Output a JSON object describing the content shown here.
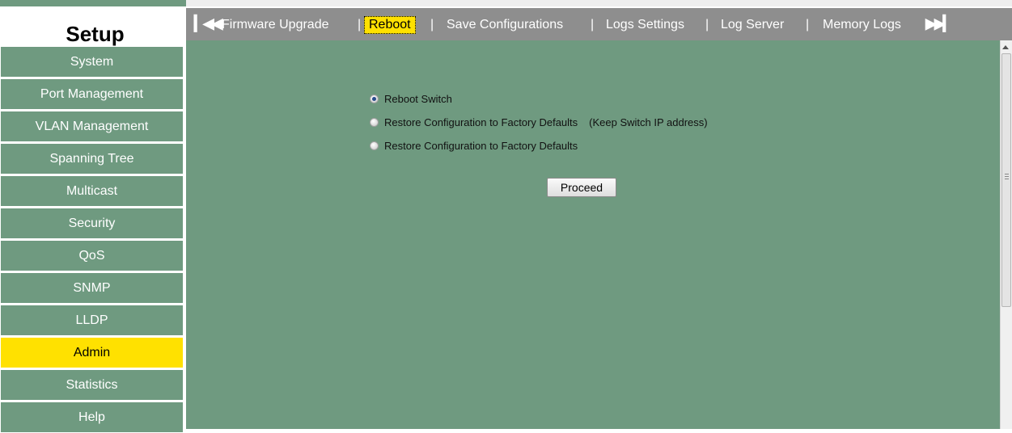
{
  "sidebar": {
    "title": "Setup",
    "items": [
      {
        "label": "System",
        "active": false
      },
      {
        "label": "Port Management",
        "active": false
      },
      {
        "label": "VLAN Management",
        "active": false
      },
      {
        "label": "Spanning Tree",
        "active": false
      },
      {
        "label": "Multicast",
        "active": false
      },
      {
        "label": "Security",
        "active": false
      },
      {
        "label": "QoS",
        "active": false
      },
      {
        "label": "SNMP",
        "active": false
      },
      {
        "label": "LLDP",
        "active": false
      },
      {
        "label": "Admin",
        "active": true
      },
      {
        "label": "Statistics",
        "active": false
      },
      {
        "label": "Help",
        "active": false
      }
    ]
  },
  "tabbar": {
    "first_icon": "skip-to-first-icon",
    "last_icon": "skip-to-last-icon",
    "separator": "|",
    "tabs": [
      {
        "label": "Firmware Upgrade",
        "active": false
      },
      {
        "label": "Reboot",
        "active": true
      },
      {
        "label": "Save Configurations",
        "active": false
      },
      {
        "label": "Logs Settings",
        "active": false
      },
      {
        "label": "Log Server",
        "active": false
      },
      {
        "label": "Memory Logs",
        "active": false
      }
    ]
  },
  "main": {
    "options": [
      {
        "label": "Reboot Switch",
        "note": "",
        "checked": true
      },
      {
        "label": "Restore Configuration to Factory Defaults",
        "note": "(Keep Switch IP address)",
        "checked": false
      },
      {
        "label": "Restore Configuration to Factory Defaults",
        "note": "",
        "checked": false
      }
    ],
    "proceed_label": "Proceed"
  },
  "colors": {
    "panel_green": "#6f9a80",
    "active_yellow": "#ffe100",
    "tabbar_gray": "#8e8e8e"
  }
}
